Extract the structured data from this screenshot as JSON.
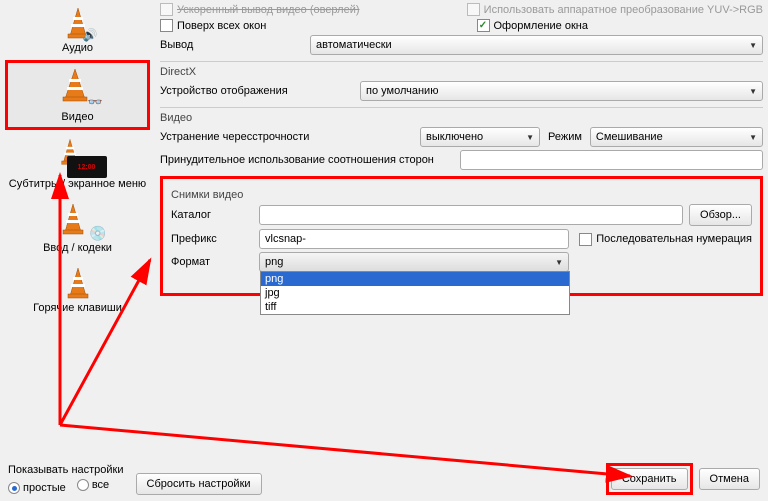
{
  "sidebar": {
    "items": [
      {
        "label": "Аудио"
      },
      {
        "label": "Видео"
      },
      {
        "label": "Субтитры / экранное меню"
      },
      {
        "label": "Ввод / кодеки"
      },
      {
        "label": "Горячие клавиши"
      }
    ],
    "selected_index": 1
  },
  "top": {
    "accel_label_truncated": "Ускоренный вывод видео (оверлей)",
    "always_on_top": {
      "checked": false,
      "label": "Поверх всех окон"
    },
    "hardware_conv_truncated": "Использовать аппаратное преобразование YUV->RGB",
    "window_deco": {
      "checked": true,
      "label": "Оформление окна"
    },
    "output_label": "Вывод",
    "output_value": "автоматически"
  },
  "directx": {
    "title": "DirectX",
    "display_device_label": "Устройство отображения",
    "display_device_value": "по умолчанию"
  },
  "video": {
    "title": "Видео",
    "deinterlace_label": "Устранение чересстрочности",
    "deinterlace_value": "выключено",
    "mode_label": "Режим",
    "mode_value": "Смешивание",
    "force_aspect_label": "Принудительное использование соотношения сторон",
    "force_aspect_value": ""
  },
  "snapshots": {
    "title": "Снимки видео",
    "dir_label": "Каталог",
    "dir_value": "",
    "browse_label": "Обзор...",
    "prefix_label": "Префикс",
    "prefix_value": "vlcsnap-",
    "sequential": {
      "checked": false,
      "label": "Последовательная нумерация"
    },
    "format_label": "Формат",
    "format_value": "png",
    "format_options": [
      "png",
      "jpg",
      "tiff"
    ]
  },
  "bottom": {
    "show_settings_label": "Показывать настройки",
    "radio_simple": "простые",
    "radio_all": "все",
    "reset_label": "Сбросить настройки",
    "save_label": "Сохранить",
    "cancel_label": "Отмена"
  }
}
